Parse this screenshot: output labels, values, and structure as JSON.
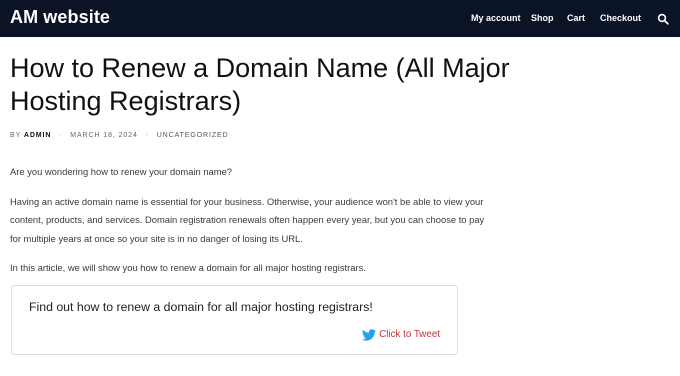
{
  "site": {
    "logo": "AM website",
    "nav": [
      "My account",
      "Shop",
      "Cart",
      "Checkout"
    ]
  },
  "post": {
    "title": "How to Renew a Domain Name (All Major Hosting Registrars)",
    "meta": {
      "by": "BY",
      "author": "ADMIN",
      "separator": "-",
      "date": "MARCH 18, 2024",
      "category": "UNCATEGORIZED"
    },
    "paragraphs": [
      "Are you wondering how to renew your domain name?",
      "Having an active domain name is essential for your business. Otherwise, your audience won't be able to view your content, products, and services. Domain registration renewals often happen every year, but you can choose to pay for multiple years at once so your site is in no danger of losing its URL.",
      "In this article, we will show you how to renew a domain for all major hosting registrars."
    ],
    "tweet_box": {
      "text": "Find out how to renew a domain for all major hosting registrars!",
      "cta": "Click to Tweet",
      "icon": "twitter-bird-icon",
      "icon_color": "#1da1f2",
      "cta_color": "#c6323a"
    }
  },
  "colors": {
    "header_bg": "#0b1326",
    "header_text": "#ffffff"
  }
}
